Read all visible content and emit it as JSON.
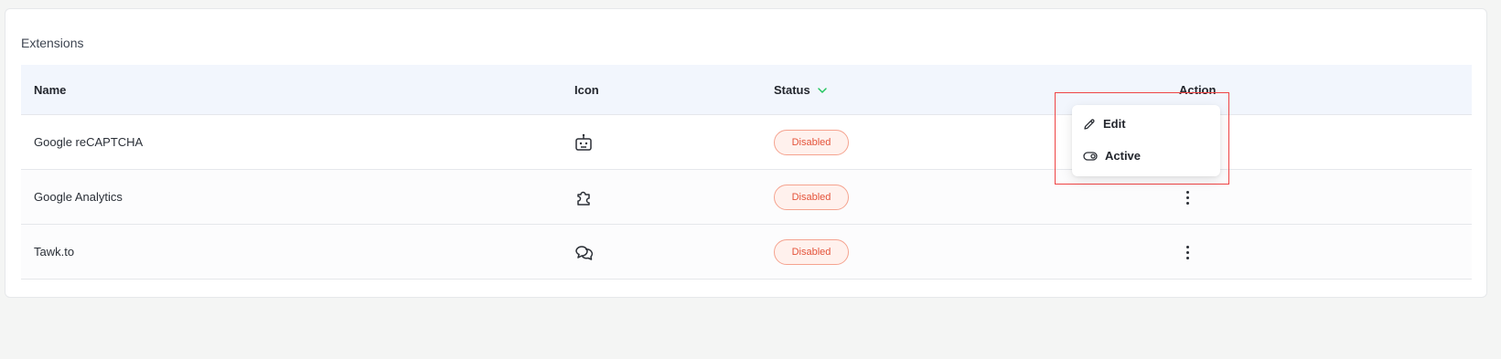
{
  "card": {
    "title": "Extensions"
  },
  "table": {
    "headers": {
      "name": "Name",
      "icon": "Icon",
      "status": "Status",
      "action": "Action"
    },
    "rows": [
      {
        "name": "Google reCAPTCHA",
        "icon": "robot-icon",
        "status": "Disabled"
      },
      {
        "name": "Google Analytics",
        "icon": "puzzle-icon",
        "status": "Disabled"
      },
      {
        "name": "Tawk.to",
        "icon": "chat-bubbles-icon",
        "status": "Disabled"
      }
    ]
  },
  "dropdown": {
    "items": [
      {
        "label": "Edit",
        "icon": "pencil-icon"
      },
      {
        "label": "Active",
        "icon": "toggle-icon"
      }
    ]
  },
  "colors": {
    "badge_text": "#e4533a",
    "badge_border": "#f5a38f",
    "sort_indicator": "#22c55e",
    "highlight": "#ef4444"
  }
}
